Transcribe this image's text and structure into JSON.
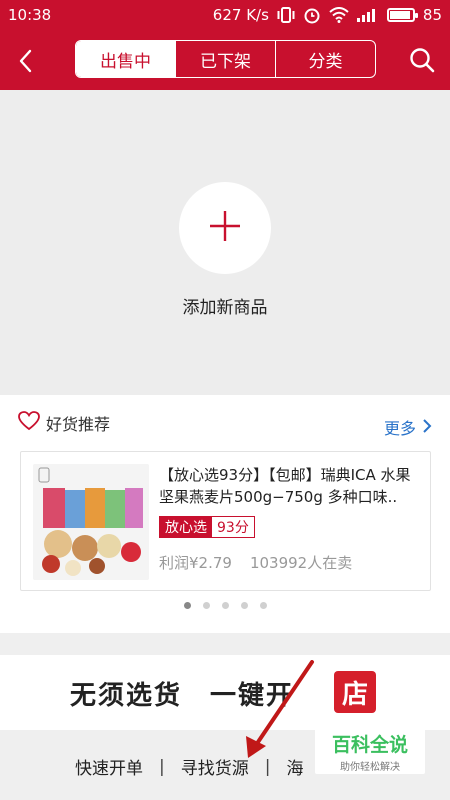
{
  "status_bar": {
    "time": "10:38",
    "speed": "627 K/s",
    "battery": "85",
    "battery_level": 0.85
  },
  "header": {
    "tabs": [
      "出售中",
      "已下架",
      "分类"
    ],
    "active_tab_index": 0
  },
  "add_product": {
    "label": "添加新商品"
  },
  "recommend": {
    "title": "好货推荐",
    "more": "更多",
    "product": {
      "title": "【放心选93分】【包邮】瑞典ICA 水果坚果燕麦片500g−750g 多种口味..",
      "tag_label": "放心选",
      "tag_score": "93分",
      "profit": "利润¥2.79",
      "sellers": "103992人在卖"
    },
    "pagination": {
      "count": 5,
      "active_index": 0
    }
  },
  "banner": {
    "text": "无须选货　一键开",
    "store_char": "店"
  },
  "bottom_links": [
    "快速开单",
    "寻找货源",
    "海"
  ],
  "watermark": {
    "title": "百科全说",
    "subtitle": "助你轻松解决"
  },
  "colors": {
    "brand_red": "#c8102e",
    "link_blue": "#2a73c9",
    "watermark_green": "#3bbf5f"
  }
}
